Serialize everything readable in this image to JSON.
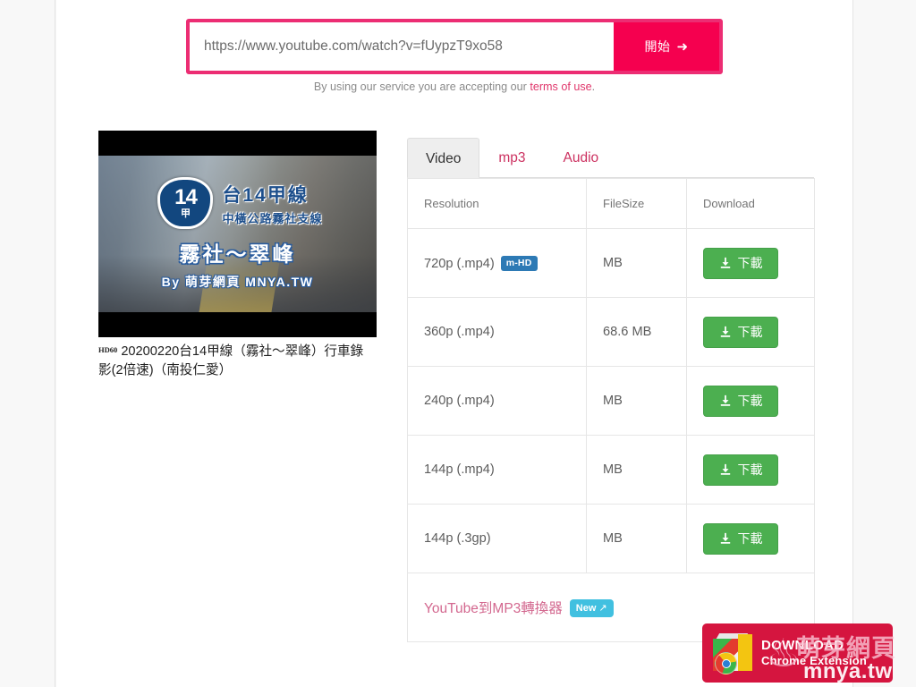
{
  "search": {
    "url_value": "https://www.youtube.com/watch?v=fUypzT9xo58",
    "placeholder": "https://www.youtube.com/watch?v=",
    "start_label": "開始",
    "start_arrow": "➜",
    "accent_color": "#ec2d73",
    "button_color": "#f5004f"
  },
  "terms": {
    "prefix": "By using our service you are accepting our ",
    "link": "terms of use",
    "suffix": "."
  },
  "video": {
    "thumbnail": {
      "shield_number": "14",
      "shield_suffix": "甲",
      "road_name": "台14甲線",
      "road_sub": "中橫公路霧社支線",
      "segment": "霧社～翠峰",
      "byline": "By 萌芽網頁 MNYA.TW"
    },
    "hd_flag": "HD60",
    "title": "20200220台14甲線（霧社～翠峰）行車錄影(2倍速)（南投仁愛）"
  },
  "tabs": [
    {
      "label": "Video",
      "active": true
    },
    {
      "label": "mp3",
      "active": false
    },
    {
      "label": "Audio",
      "active": false
    }
  ],
  "table": {
    "headers": [
      "Resolution",
      "FileSize",
      "Download"
    ],
    "download_label": "下載",
    "rows": [
      {
        "resolution": "720p (.mp4)",
        "badge": "m-HD",
        "filesize": "MB"
      },
      {
        "resolution": "360p (.mp4)",
        "badge": "",
        "filesize": "68.6 MB"
      },
      {
        "resolution": "240p (.mp4)",
        "badge": "",
        "filesize": "MB"
      },
      {
        "resolution": "144p (.mp4)",
        "badge": "",
        "filesize": "MB"
      },
      {
        "resolution": "144p (.3gp)",
        "badge": "",
        "filesize": "MB"
      }
    ],
    "footer_link": "YouTube到MP3轉換器",
    "footer_badge": "New"
  },
  "extension_banner": {
    "line1": "DOWNLOAD",
    "line2": "Chrome Extension",
    "background_color": "#d5153f"
  },
  "watermark": {
    "chinese": "萌芽網頁",
    "english": "mnya.tw"
  }
}
